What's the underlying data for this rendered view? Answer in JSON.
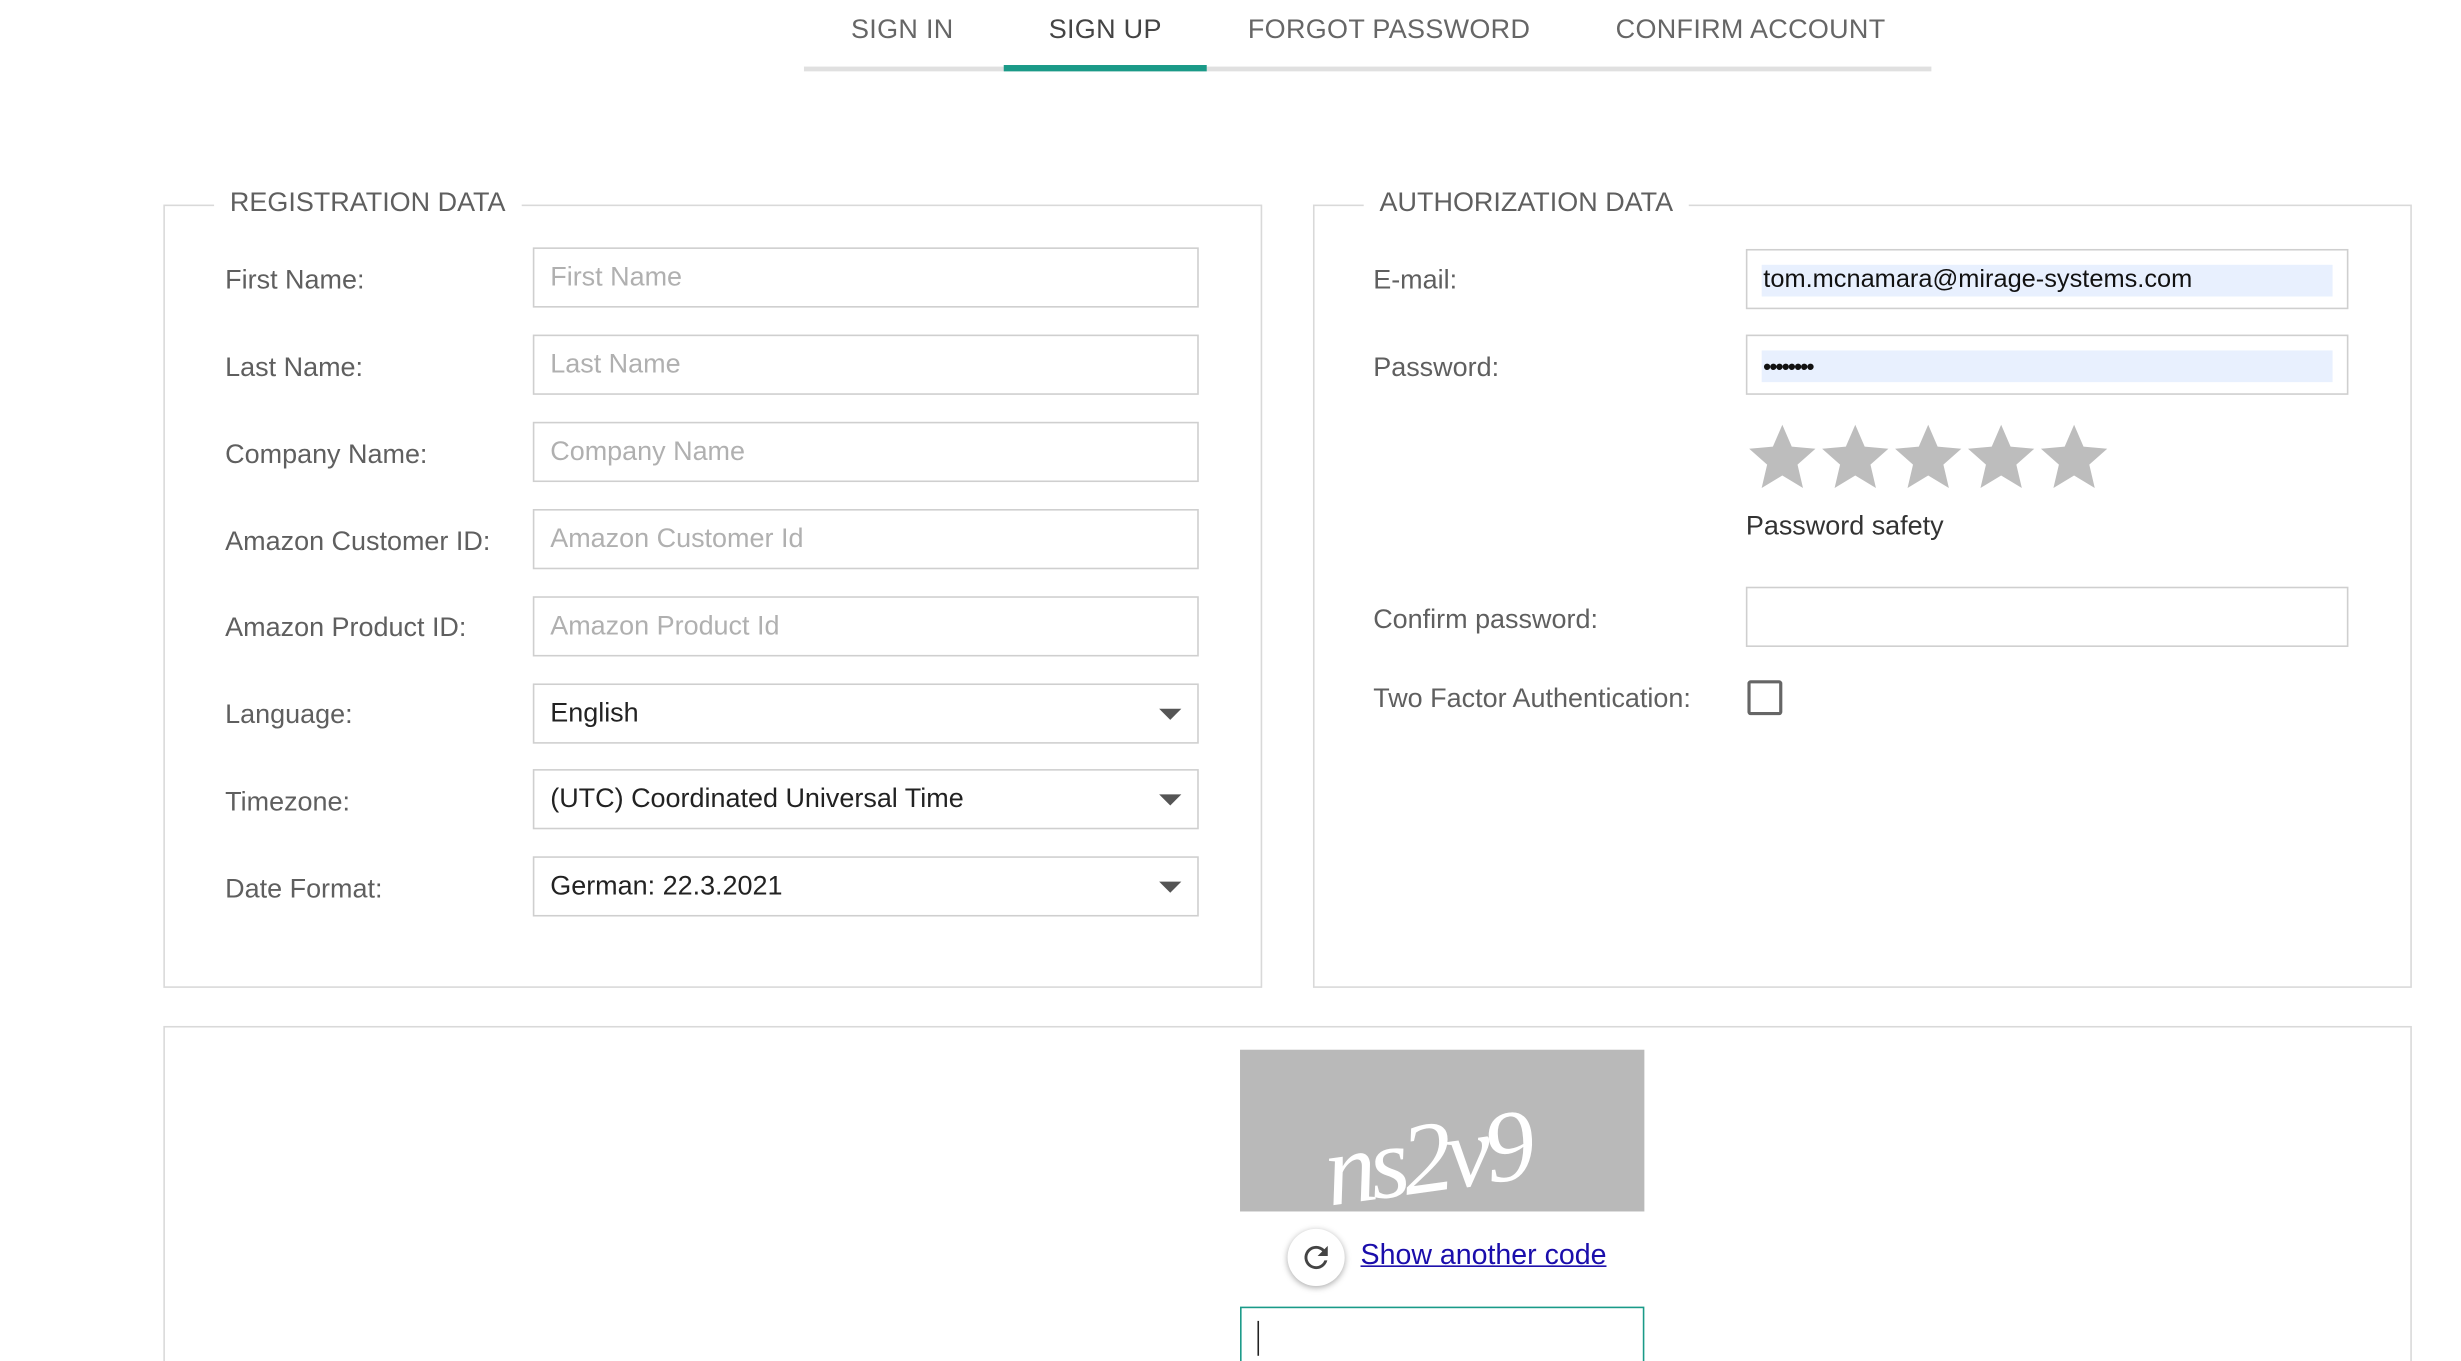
{
  "tabs": {
    "sign_in": "SIGN IN",
    "sign_up": "SIGN UP",
    "forgot_password": "FORGOT PASSWORD",
    "confirm_account": "CONFIRM ACCOUNT",
    "active": "SIGN UP"
  },
  "registration": {
    "legend": "REGISTRATION DATA",
    "first_name": {
      "label": "First Name:",
      "placeholder": "First Name",
      "value": ""
    },
    "last_name": {
      "label": "Last Name:",
      "placeholder": "Last Name",
      "value": ""
    },
    "company_name": {
      "label": "Company Name:",
      "placeholder": "Company Name",
      "value": ""
    },
    "amazon_customer_id": {
      "label": "Amazon Customer ID:",
      "placeholder": "Amazon Customer Id",
      "value": ""
    },
    "amazon_product_id": {
      "label": "Amazon Product ID:",
      "placeholder": "Amazon Product Id",
      "value": ""
    },
    "language": {
      "label": "Language:",
      "value": "English"
    },
    "timezone": {
      "label": "Timezone:",
      "value": "(UTC) Coordinated Universal Time"
    },
    "date_format": {
      "label": "Date Format:",
      "value": "German: 22.3.2021"
    }
  },
  "authorization": {
    "legend": "AUTHORIZATION DATA",
    "email": {
      "label": "E-mail:",
      "value": "tom.mcnamara@mirage-systems.com"
    },
    "password": {
      "label": "Password:",
      "value": "••••••••"
    },
    "password_safety": {
      "label": "Password safety",
      "stars_total": 5,
      "stars_filled": 0
    },
    "confirm_password": {
      "label": "Confirm password:",
      "value": ""
    },
    "two_factor": {
      "label": "Two Factor Authentication:",
      "checked": false
    }
  },
  "captcha": {
    "code_text": "ns2v9",
    "show_another_label": "Show another code",
    "input_value": ""
  },
  "colors": {
    "accent": "#1a9a88",
    "link": "#1a0dab",
    "star_empty": "#bdbdbd",
    "autofill": "#e8f0fe"
  },
  "icons": {
    "refresh": "refresh-icon",
    "caret": "chevron-down-icon",
    "star": "star-icon"
  }
}
